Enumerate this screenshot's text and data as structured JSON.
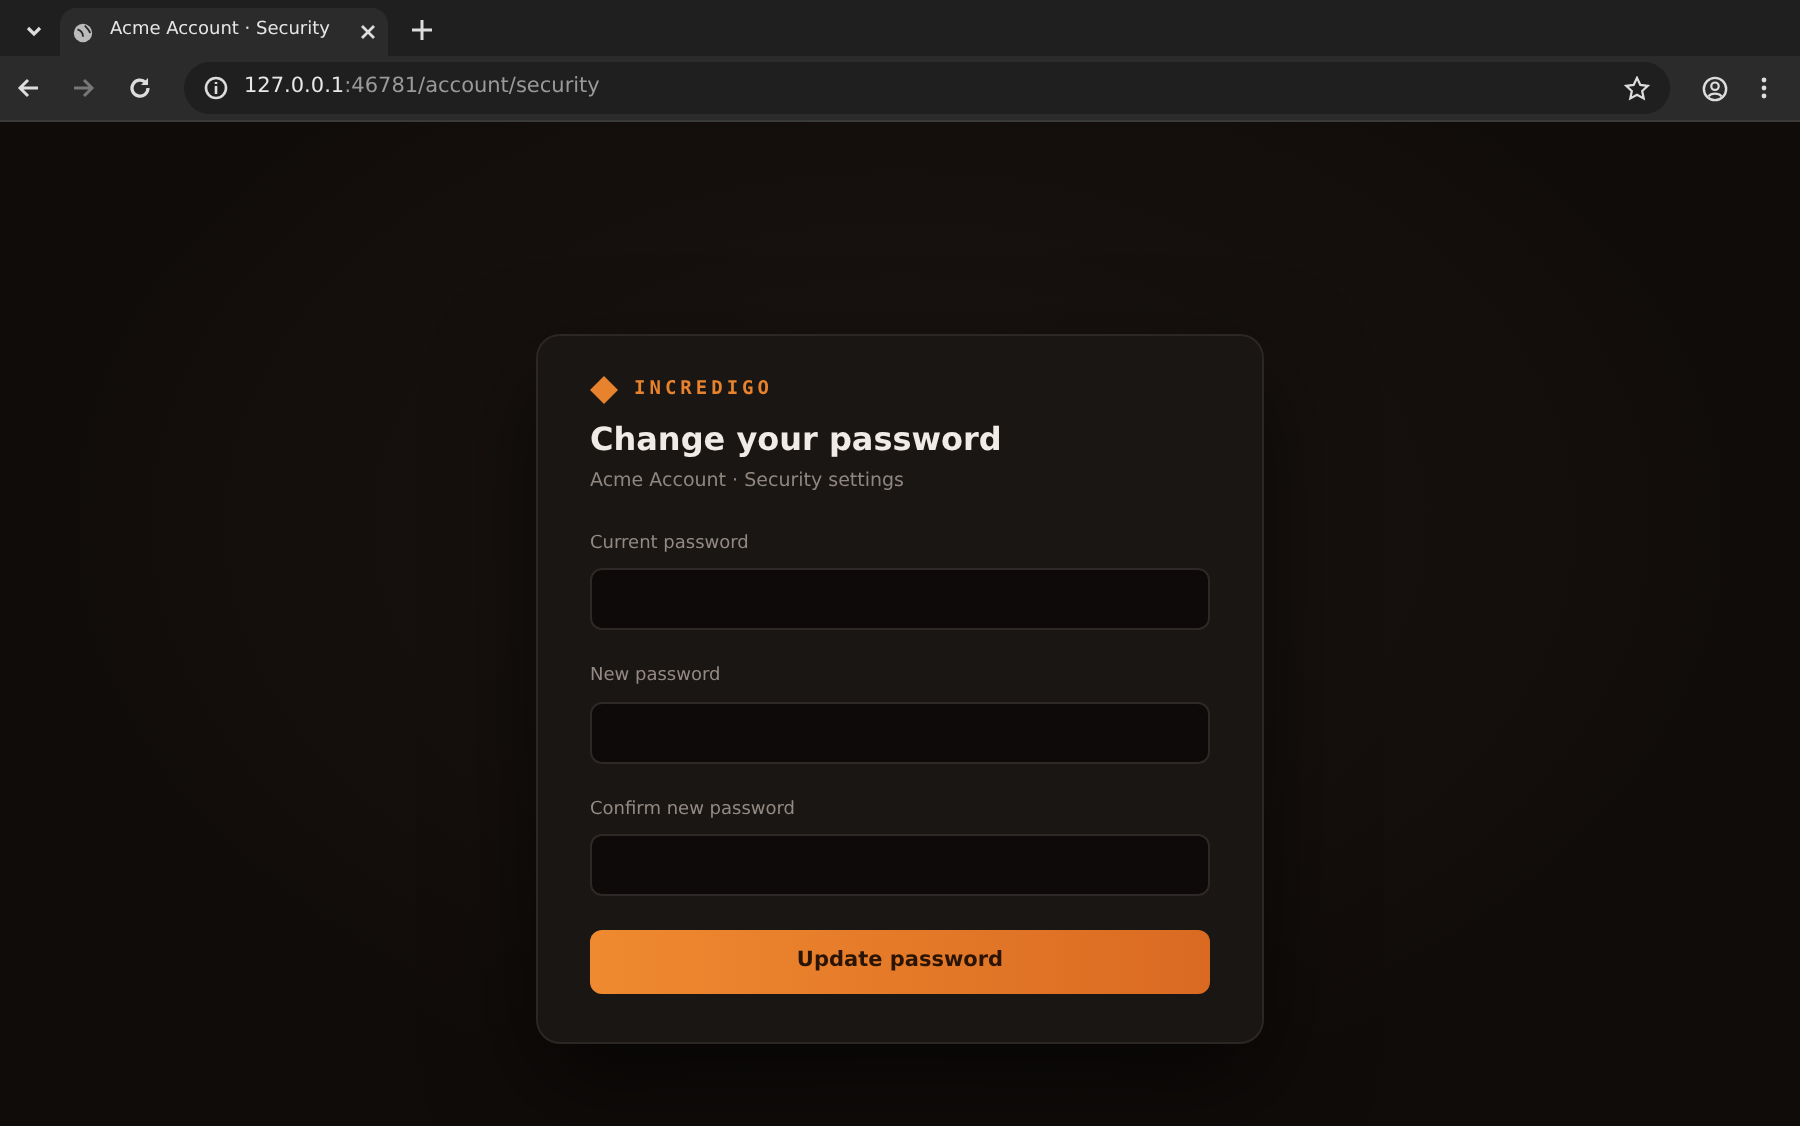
{
  "browser": {
    "tabs": [
      {
        "title": "Acme Account · Security",
        "selected": true
      }
    ],
    "url_host": "127.0.0.1",
    "url_rest": ":46781/account/security"
  },
  "card": {
    "brand": "INCREDIGO",
    "title": "Change your password",
    "subtitle": "Acme Account · Security settings",
    "fields": [
      {
        "label": "Current password"
      },
      {
        "label": "New password"
      },
      {
        "label": "Confirm new password"
      }
    ],
    "submit": "Update password"
  }
}
